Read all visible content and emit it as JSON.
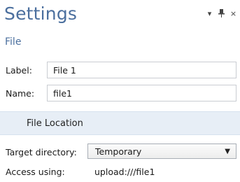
{
  "panel": {
    "title": "Settings",
    "subtitle": "File",
    "controls": {
      "dropdown_glyph": "▾",
      "pin_glyph": "⊥",
      "close_glyph": "×"
    }
  },
  "fields": {
    "label_caption": "Label:",
    "label_value": "File 1",
    "name_caption": "Name:",
    "name_value": "file1"
  },
  "section": {
    "title": "File Location"
  },
  "location": {
    "target_caption": "Target directory:",
    "target_value": "Temporary",
    "dropdown_arrow": "▼",
    "access_caption": "Access using:",
    "access_value": "upload:///file1"
  },
  "colors": {
    "title": "#4b6f9e",
    "section_bg": "#e7eef6"
  }
}
